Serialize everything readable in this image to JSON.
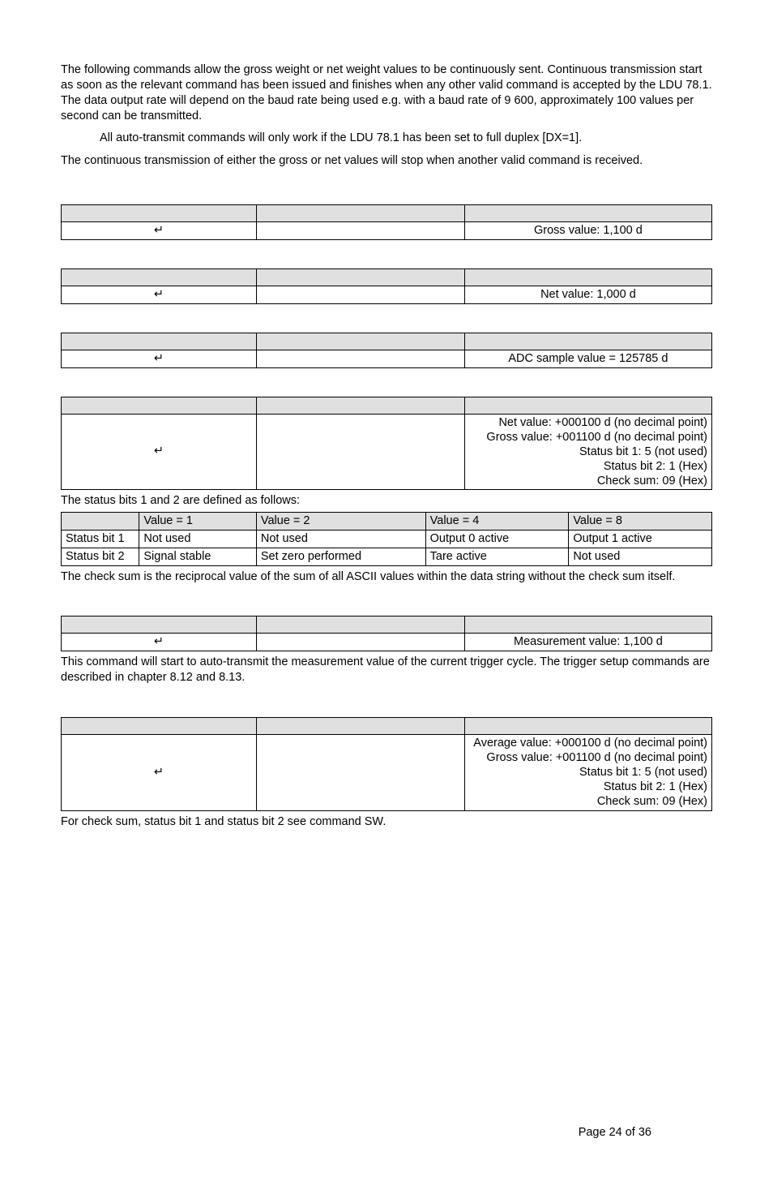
{
  "intro": {
    "p1": "The following commands allow the gross weight or net weight values to be continuously sent. Continuous transmission start as soon as the relevant command has been issued and finishes when any other valid command is accepted by the LDU 78.1. The data output rate will depend on the baud rate being used e.g. with a baud rate of 9 600, approximately 100 values per second can be transmitted.",
    "p2": "All auto-transmit commands will only work if the LDU 78.1 has been set to full duplex [DX=1].",
    "p3": "The continuous transmission of either the gross or net values will stop when another valid command is received."
  },
  "glyph": "↵",
  "tables": {
    "t1": {
      "resp": "Gross value: 1,100 d"
    },
    "t2": {
      "resp": "Net value: 1,000 d"
    },
    "t3": {
      "resp": "ADC sample value = 125785 d"
    },
    "t4": {
      "l1": "Net value: +000100 d (no decimal point)",
      "l2": "Gross value: +001100 d (no decimal point)",
      "l3": "Status bit 1: 5 (not used)",
      "l4": "Status bit 2: 1 (Hex)",
      "l5": "Check sum: 09 (Hex)"
    },
    "t5": {
      "resp": "Measurement value: 1,100 d"
    },
    "t6": {
      "l1": "Average value: +000100 d (no decimal point)",
      "l2": "Gross value: +001100 d (no decimal point)",
      "l3": "Status bit 1: 5 (not used)",
      "l4": "Status bit 2: 1 (Hex)",
      "l5": "Check sum: 09 (Hex)"
    }
  },
  "statusIntro": "The status bits 1 and 2 are defined as follows:",
  "statusTable": {
    "h1": "Value = 1",
    "h2": "Value = 2",
    "h3": "Value = 4",
    "h4": "Value = 8",
    "r1c0": "Status bit 1",
    "r1c1": "Not used",
    "r1c2": "Not used",
    "r1c3": "Output 0 active",
    "r1c4": "Output 1 active",
    "r2c0": "Status bit 2",
    "r2c1": "Signal stable",
    "r2c2": "Set zero performed",
    "r2c3": "Tare active",
    "r2c4": "Not used"
  },
  "checksumNote": "The check sum is the reciprocal value of the sum of all ASCII values within the data string without the check sum itself.",
  "triggerNote": "This command will start to auto-transmit the measurement value of the current trigger cycle. The trigger setup commands are described in chapter 8.12 and 8.13.",
  "footerNote": "For check sum, status bit 1 and status bit 2 see command SW.",
  "pageNum": "Page 24 of 36"
}
